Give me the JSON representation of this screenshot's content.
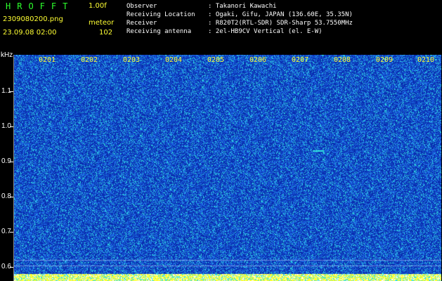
{
  "header": {
    "app_name": "HROFFT",
    "version": "1.00f",
    "filename": "2309080200.png",
    "mode": "meteor",
    "datetime": "23.09.08 02:00",
    "count": "102",
    "info_rows": [
      {
        "key": "Observer",
        "value": ": Takanori Kawachi"
      },
      {
        "key": "Receiving Location",
        "value": ": Ogaki, Gifu, JAPAN (136.60E, 35.35N)"
      },
      {
        "key": "Receiver",
        "value": ": R820T2(RTL-SDR) SDR-Sharp 53.7550MHz"
      },
      {
        "key": "Receiving antenna",
        "value": ": 2el-HB9CV Vertical (el. E-W)"
      }
    ]
  },
  "axis": {
    "unit": "kHz",
    "y_labels": [
      "1.1",
      "1.0",
      "0.9",
      "0.8",
      "0.7",
      "0.6"
    ],
    "time_labels": [
      "0201",
      "0202",
      "0203",
      "0204",
      "0205",
      "0206",
      "0207",
      "0208",
      "0209",
      "0210"
    ]
  },
  "colors": {
    "noise_dark": "#0a2fb0",
    "noise_mid": "#1f6fe8",
    "noise_hi": "#30e0e0",
    "baseline": "#ffff33"
  }
}
